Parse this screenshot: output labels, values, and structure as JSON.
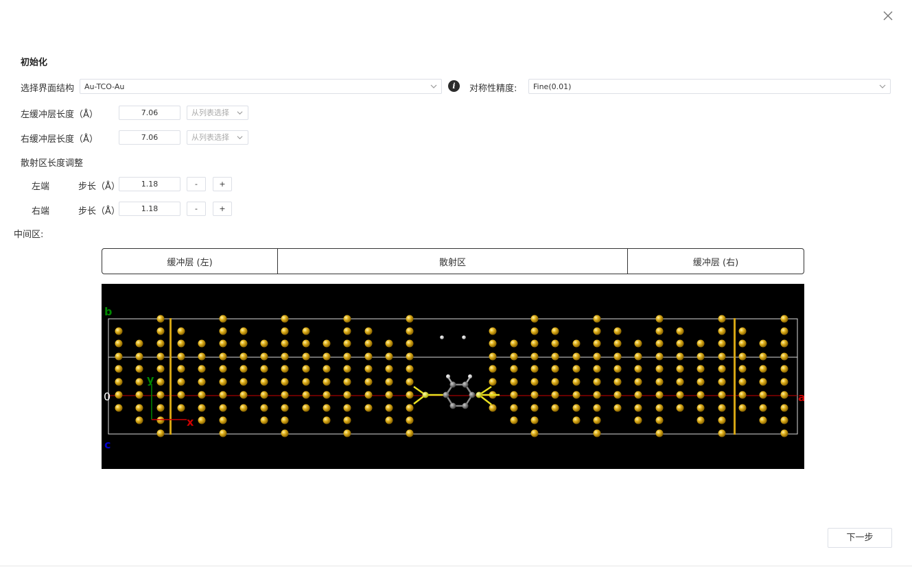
{
  "title": "初始化",
  "interface": {
    "label": "选择界面结构",
    "value": "Au-TCO-Au",
    "info_icon": "info-icon",
    "symmetry_label": "对称性精度:",
    "symmetry_value": "Fine(0.01)"
  },
  "left_buffer": {
    "label": "左缓冲层长度（Å）",
    "value": "7.06",
    "select_placeholder": "从列表选择"
  },
  "right_buffer": {
    "label": "右缓冲层长度（Å）",
    "value": "7.06",
    "select_placeholder": "从列表选择"
  },
  "scatter_adjust": {
    "label": "散射区长度调整",
    "left": {
      "label": "左端",
      "step_label": "步长（Å）",
      "value": "1.18",
      "minus": "-",
      "plus": "+"
    },
    "right": {
      "label": "右端",
      "step_label": "步长（Å）",
      "value": "1.18",
      "minus": "-",
      "plus": "+"
    }
  },
  "middle_label": "中间区:",
  "segments": [
    "缓冲层 (左)",
    "散射区",
    "缓冲层 (右)"
  ],
  "viewer": {
    "axis_b": "b",
    "axis_c": "c",
    "axis_a": "a",
    "origin": "0",
    "axis_x": "x",
    "axis_y": "y",
    "colors": {
      "gold": "#d4a514",
      "background": "#000000",
      "a_axis": "#cc0000",
      "b_axis": "#008800",
      "c_axis": "#0000cc"
    }
  },
  "next_button": "下一步",
  "close_icon": "close-icon"
}
